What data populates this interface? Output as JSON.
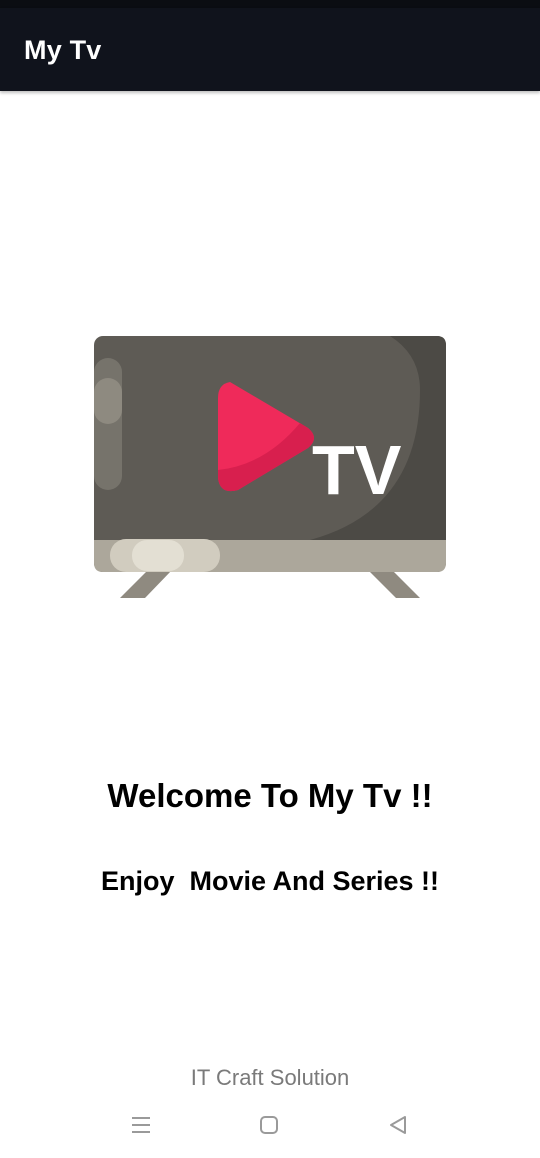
{
  "app_bar": {
    "title": "My Tv"
  },
  "illustration": {
    "icon": "tv-logo-icon",
    "logo_text": "TV",
    "colors": {
      "screen": "#5e5b55",
      "screen_shadow": "#4b4944",
      "bezel": "#a8a398",
      "play": "#ef2a5a",
      "play_dark": "#d81f4e"
    }
  },
  "main": {
    "welcome": "Welcome To My Tv !!",
    "tagline": "Enjoy  Movie And Series !!"
  },
  "footer": {
    "credit": "IT Craft Solution"
  },
  "nav_bar": {
    "menu_icon": "menu-icon",
    "home_icon": "home-icon",
    "back_icon": "back-icon"
  },
  "colors": {
    "app_bar": "#10131c",
    "text_primary": "#000000",
    "text_secondary": "#7a7a7a"
  }
}
